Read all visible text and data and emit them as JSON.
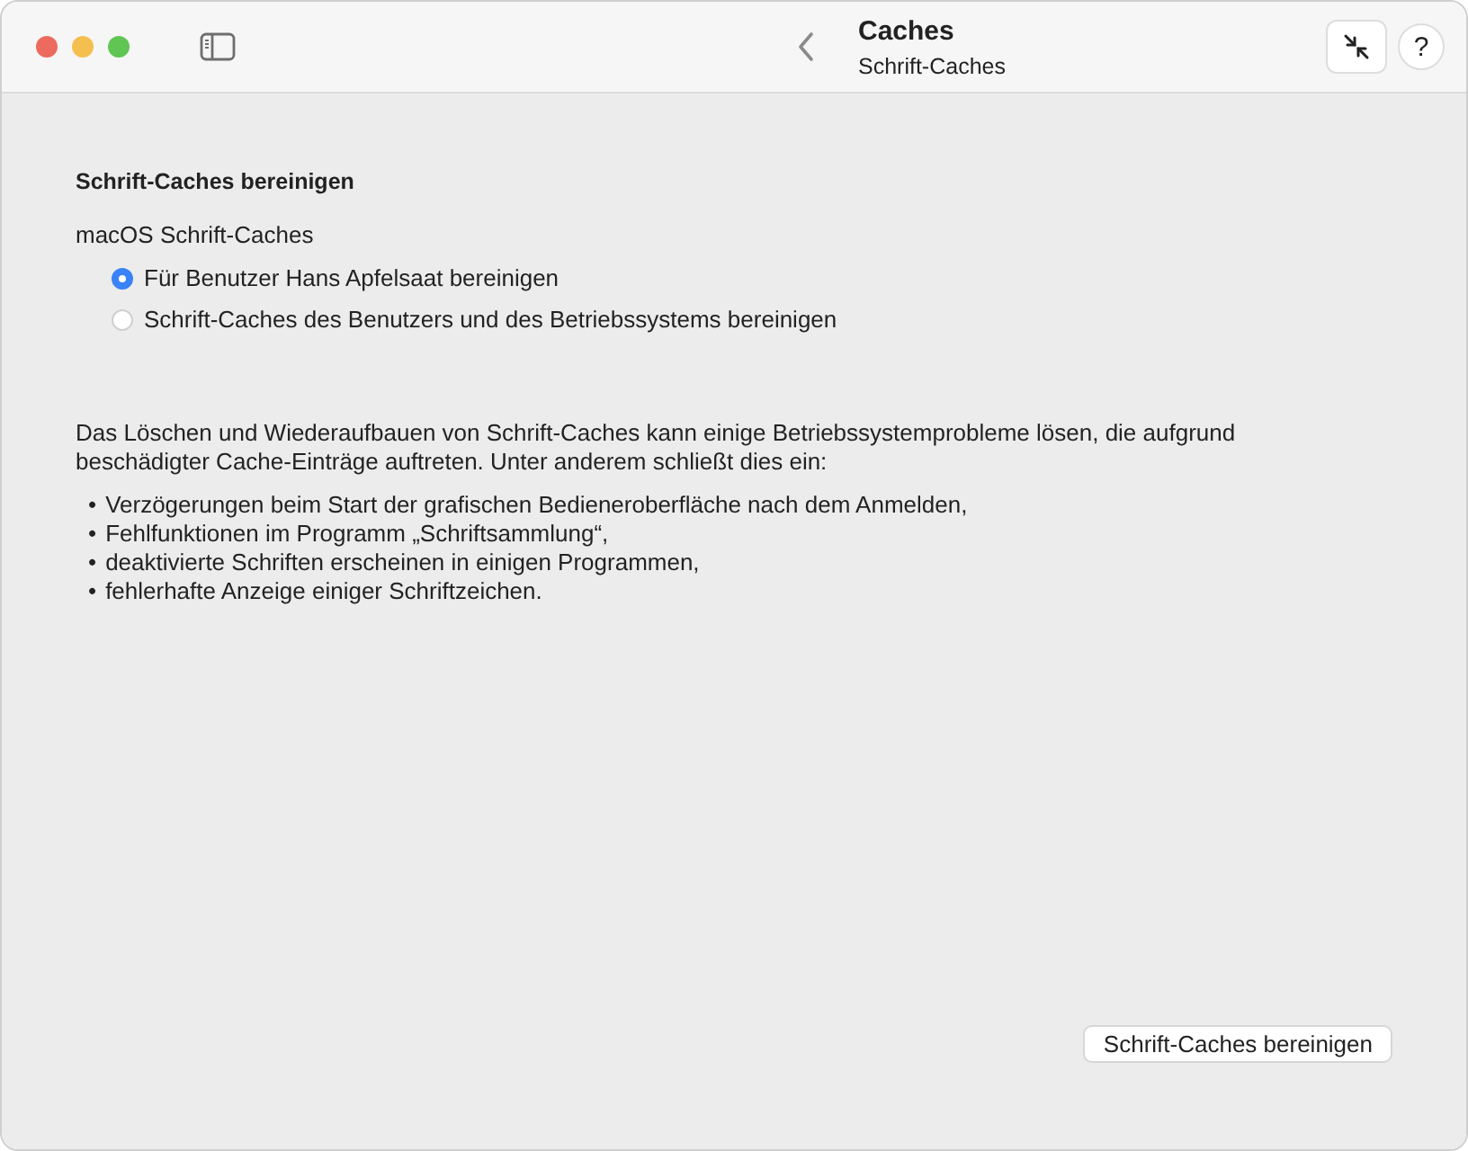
{
  "window": {
    "title": "Caches",
    "subtitle": "Schrift-Caches"
  },
  "toolbar": {
    "help": "?"
  },
  "section": {
    "heading": "Schrift-Caches bereinigen",
    "group_label": "macOS Schrift-Caches",
    "options": [
      {
        "label": "Für Benutzer Hans Apfelsaat bereinigen",
        "selected": true
      },
      {
        "label": "Schrift-Caches des Benutzers und des Betriebssystems bereinigen",
        "selected": false
      }
    ]
  },
  "description": "Das Löschen und Wiederaufbauen von Schrift-Caches kann einige Betriebssystemprobleme lösen, die aufgrund beschädigter Cache-Einträge auftreten. Unter anderem schließt dies ein:",
  "bullets": [
    {
      "bullet": "•",
      "text": "Verzögerungen beim Start der grafischen Bedieneroberfläche nach dem Anmelden,"
    },
    {
      "bullet": "•",
      "text": "Fehlfunktionen im Programm „Schriftsammlung“,"
    },
    {
      "bullet": "•",
      "text": "deaktivierte Schriften erscheinen in einigen Programmen,"
    },
    {
      "bullet": "•",
      "text": "fehlerhafte Anzeige einiger Schriftzeichen."
    }
  ],
  "action_button": "Schrift-Caches bereinigen"
}
